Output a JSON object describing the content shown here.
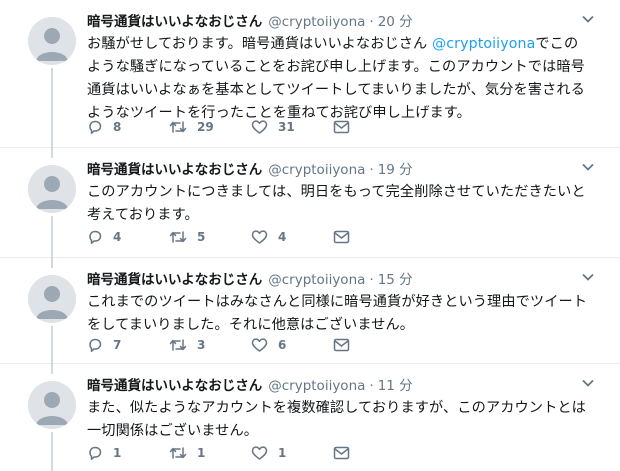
{
  "tweets": [
    {
      "name": "暗号通貨はいいよなおじさん",
      "handle": "@cryptoiiyona",
      "dot": "·",
      "time": "20 分",
      "text_before": "お騒がせしております。暗号通貨はいいよなおじさん ",
      "mention": "@cryptoiiyona",
      "text_after": "でこのような騒ぎになっていることをお詫び申し上げます。このアカウントでは暗号通貨はいいよなぁを基本としてツイートしてまいりましたが、気分を害されるようなツイートを行ったことを重ねてお詫び申し上げます。",
      "replies": "8",
      "retweets": "29",
      "likes": "31"
    },
    {
      "name": "暗号通貨はいいよなおじさん",
      "handle": "@cryptoiiyona",
      "dot": "·",
      "time": "19 分",
      "text": "このアカウントにつきましては、明日をもって完全削除させていただきたいと考えております。",
      "replies": "4",
      "retweets": "5",
      "likes": "4"
    },
    {
      "name": "暗号通貨はいいよなおじさん",
      "handle": "@cryptoiiyona",
      "dot": "·",
      "time": "15 分",
      "text": "これまでのツイートはみなさんと同様に暗号通貨が好きという理由でツイートをしてまいりました。それに他意はございません。",
      "replies": "7",
      "retweets": "3",
      "likes": "6"
    },
    {
      "name": "暗号通貨はいいよなおじさん",
      "handle": "@cryptoiiyona",
      "dot": "·",
      "time": "11 分",
      "text": "また、似たようなアカウントを複数確認しておりますが、このアカウントとは一切関係はございません。",
      "replies": "1",
      "retweets": "1",
      "likes": "1"
    }
  ],
  "colors": {
    "text": "#14171a",
    "secondary": "#657786",
    "link": "#1da1f2",
    "divider": "#e6ecf0",
    "avatar_bg": "#dfe3e8",
    "thread_line": "#cfd9de"
  },
  "icons": [
    "reply-icon",
    "retweet-icon",
    "like-icon",
    "dm-icon",
    "chevron-down-icon",
    "default-avatar-icon"
  ]
}
